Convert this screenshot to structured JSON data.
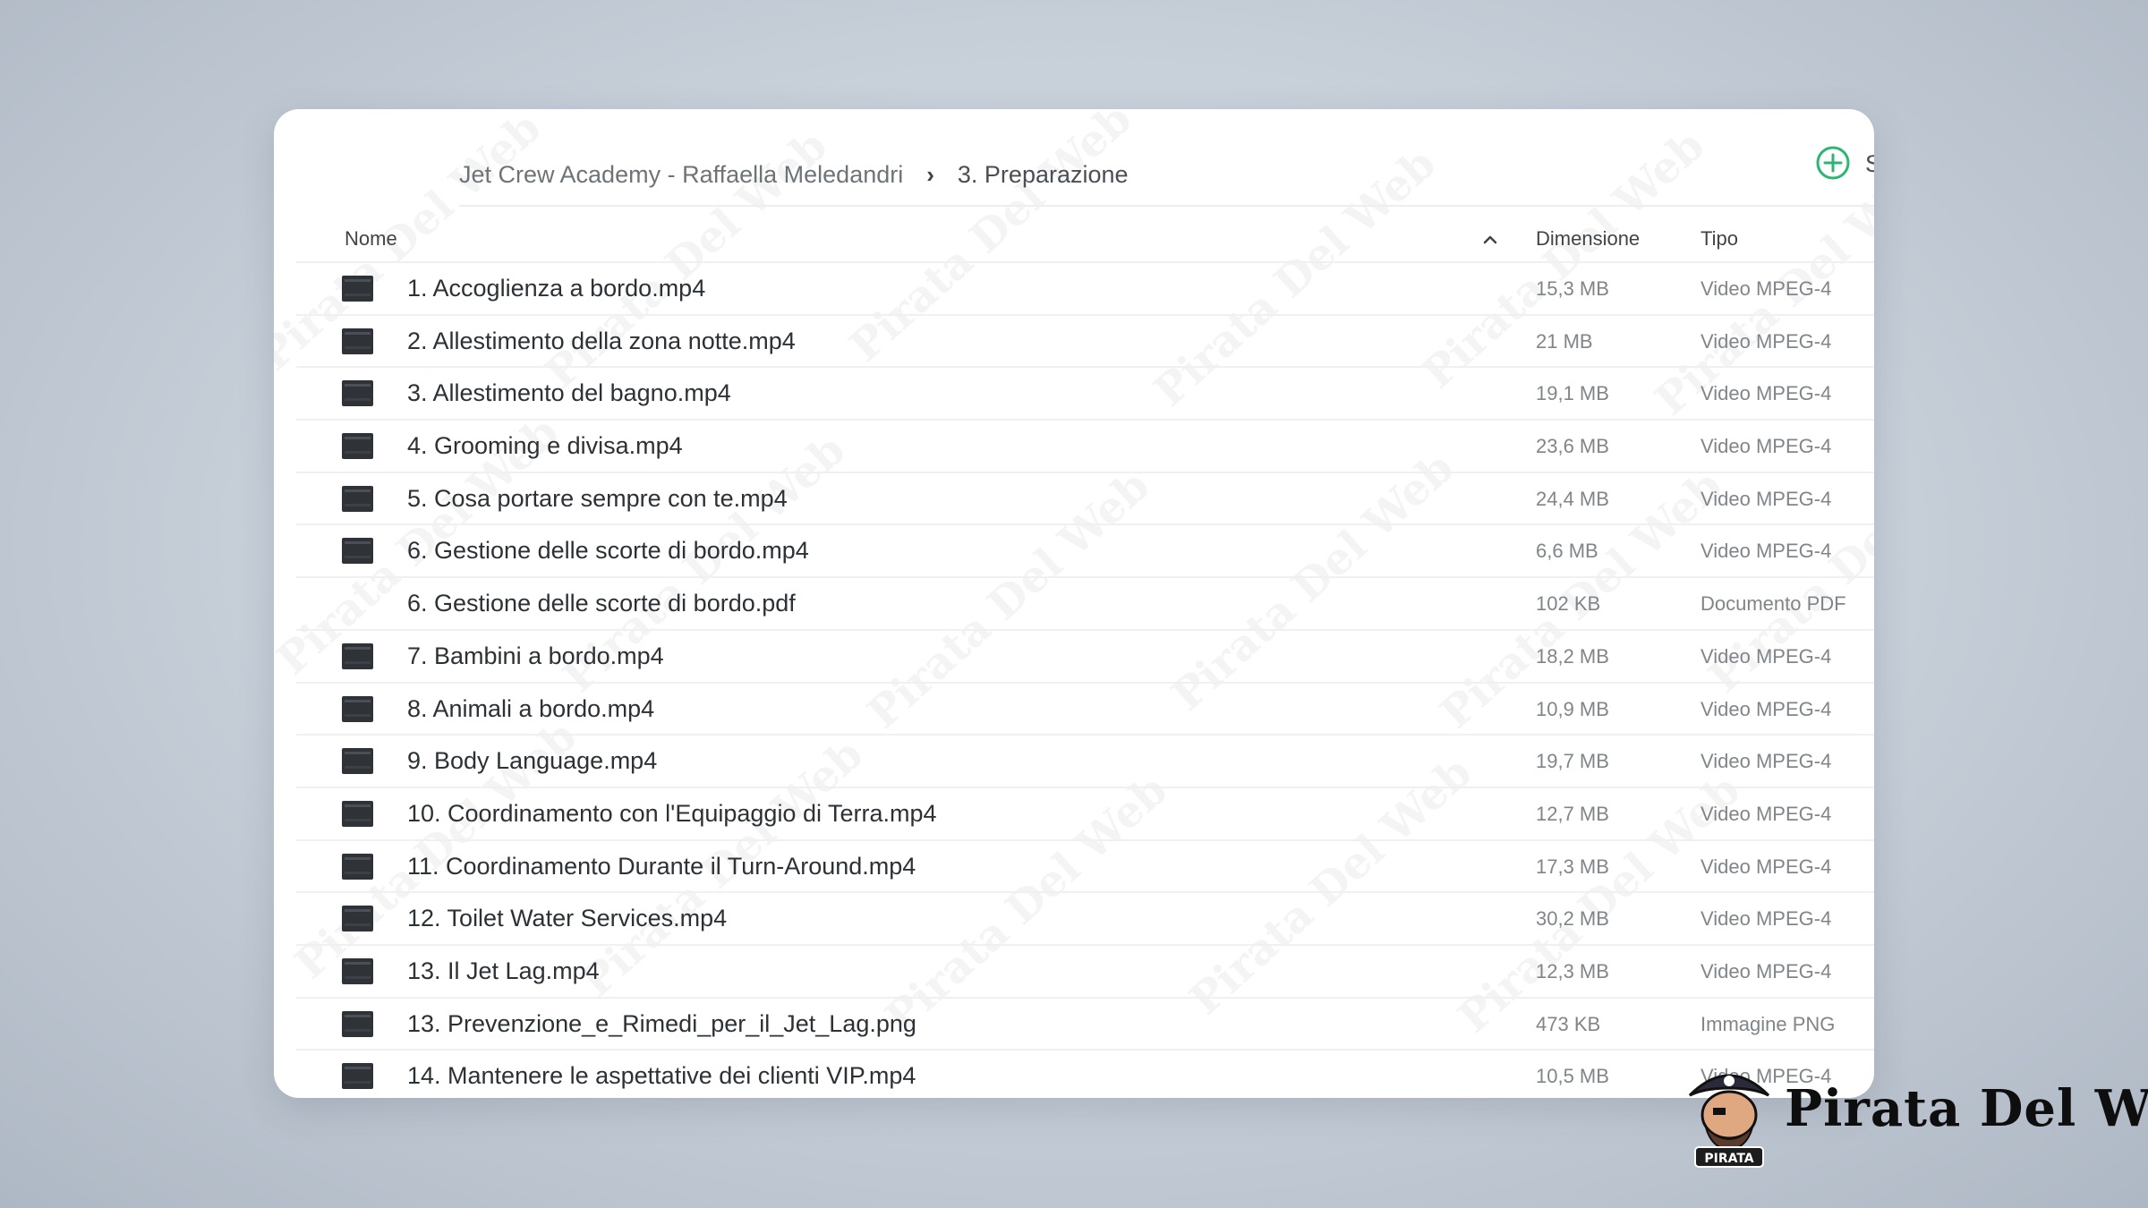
{
  "breadcrumb": {
    "parent": "Jet Crew Academy - Raffaella Meledandri",
    "separator": "›",
    "current": "3. Preparazione"
  },
  "toolbar": {
    "add_icon": "plus-circle-icon",
    "add_label": "S",
    "accent_color": "#2bb673"
  },
  "columns": {
    "name": "Nome",
    "sort_icon": "chevron-up-icon",
    "size": "Dimensione",
    "type": "Tipo"
  },
  "files": [
    {
      "name": "1. Accoglienza a bordo.mp4",
      "size": "15,3 MB",
      "type": "Video MPEG-4",
      "thumb": true
    },
    {
      "name": "2. Allestimento della zona notte.mp4",
      "size": "21 MB",
      "type": "Video MPEG-4",
      "thumb": true
    },
    {
      "name": "3. Allestimento del bagno.mp4",
      "size": "19,1 MB",
      "type": "Video MPEG-4",
      "thumb": true
    },
    {
      "name": "4. Grooming e divisa.mp4",
      "size": "23,6 MB",
      "type": "Video MPEG-4",
      "thumb": true
    },
    {
      "name": "5. Cosa portare sempre con te.mp4",
      "size": "24,4 MB",
      "type": "Video MPEG-4",
      "thumb": true
    },
    {
      "name": "6. Gestione delle scorte di bordo.mp4",
      "size": "6,6 MB",
      "type": "Video MPEG-4",
      "thumb": true
    },
    {
      "name": "6. Gestione delle scorte di bordo.pdf",
      "size": "102 KB",
      "type": "Documento PDF",
      "thumb": false
    },
    {
      "name": "7. Bambini a bordo.mp4",
      "size": "18,2 MB",
      "type": "Video MPEG-4",
      "thumb": true
    },
    {
      "name": "8. Animali a bordo.mp4",
      "size": "10,9 MB",
      "type": "Video MPEG-4",
      "thumb": true
    },
    {
      "name": "9. Body Language.mp4",
      "size": "19,7 MB",
      "type": "Video MPEG-4",
      "thumb": true
    },
    {
      "name": "10. Coordinamento con l'Equipaggio di Terra.mp4",
      "size": "12,7 MB",
      "type": "Video MPEG-4",
      "thumb": true
    },
    {
      "name": "11. Coordinamento Durante il Turn-Around.mp4",
      "size": "17,3 MB",
      "type": "Video MPEG-4",
      "thumb": true
    },
    {
      "name": "12. Toilet Water Services.mp4",
      "size": "30,2 MB",
      "type": "Video MPEG-4",
      "thumb": true
    },
    {
      "name": "13. Il Jet Lag.mp4",
      "size": "12,3 MB",
      "type": "Video MPEG-4",
      "thumb": true
    },
    {
      "name": "13. Prevenzione_e_Rimedi_per_il_Jet_Lag.png",
      "size": "473 KB",
      "type": "Immagine PNG",
      "thumb": true
    },
    {
      "name": "14. Mantenere le aspettative dei clienti VIP.mp4",
      "size": "10,5 MB",
      "type": "Video MPEG-4",
      "thumb": true
    }
  ],
  "watermark": {
    "text": "Pirata Del Web"
  },
  "logo": {
    "text": "Pirata Del Web",
    "badge_text": "PIRATA"
  }
}
